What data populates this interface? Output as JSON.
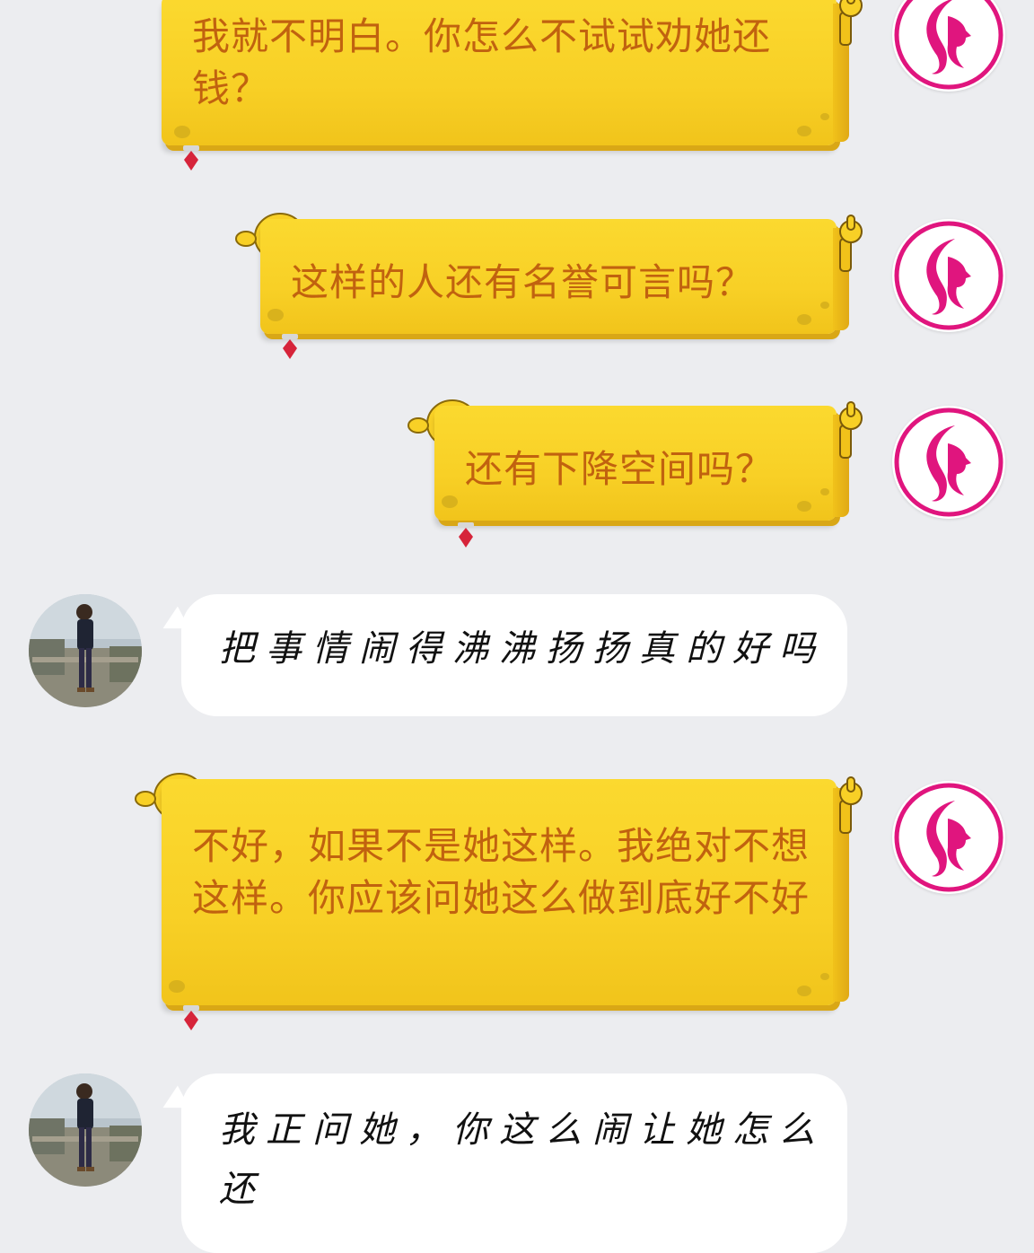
{
  "chat": {
    "messages": [
      {
        "sender": "brand",
        "text": "我就不明白。你怎么不试试劝她还钱？"
      },
      {
        "sender": "brand",
        "text": "这样的人还有名誉可言吗？"
      },
      {
        "sender": "brand",
        "text": "还有下降空间吗？"
      },
      {
        "sender": "user",
        "text": "把事情闹得沸沸扬扬真的好吗"
      },
      {
        "sender": "brand",
        "text": "不好，如果不是她这样。我绝对不想这样。你应该问她这么做到底好不好"
      },
      {
        "sender": "user",
        "text": "我正问她，你这么闹让她怎么还"
      }
    ]
  },
  "colors": {
    "background": "#ecedf0",
    "bubble_yellow": "#f8d026",
    "bubble_text_orange": "#c1620f",
    "bubble_white": "#ffffff",
    "brand_magenta": "#e0157e"
  },
  "icons": {
    "brand_avatar": "woman-silhouette-icon",
    "user_avatar": "person-photo",
    "bubble_decoration": "spongebob-sticker-icon"
  }
}
